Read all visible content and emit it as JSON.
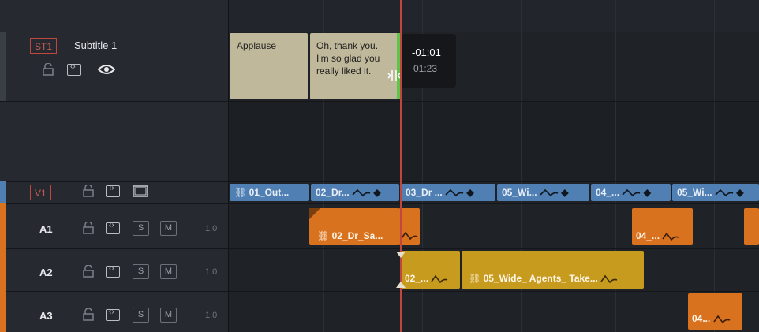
{
  "subtitle_track": {
    "badge": "ST1",
    "name": "Subtitle 1",
    "clips": [
      {
        "text": "Applause"
      },
      {
        "lines": [
          "Oh, thank you.",
          "I'm so glad you",
          "really liked it."
        ]
      }
    ]
  },
  "trim_tooltip": {
    "offset": "-01:01",
    "duration": "01:23"
  },
  "video_track": {
    "badge": "V1",
    "clips": [
      "01_Out...",
      "02_Dr...",
      "03_Dr ...",
      "05_Wi...",
      "04_...",
      "05_Wi..."
    ]
  },
  "audio_tracks": [
    {
      "name": "A1",
      "volume": "1.0",
      "solo": "S",
      "mute": "M",
      "clips": [
        "02_Dr_Sa...",
        "04_..."
      ]
    },
    {
      "name": "A2",
      "volume": "1.0",
      "solo": "S",
      "mute": "M",
      "clips": [
        "02_...",
        "05_Wide_ Agents_ Take..."
      ]
    },
    {
      "name": "A3",
      "volume": "1.0",
      "solo": "S",
      "mute": "M",
      "clips": [
        "04..."
      ]
    }
  ],
  "colors": {
    "subtitle_clip": "#c0b89a",
    "video_clip": "#4f7fb3",
    "audio_orange": "#d9721f",
    "audio_yellow": "#c79b1e",
    "playhead": "#c0473e",
    "trim_edge": "#5fc54a"
  }
}
